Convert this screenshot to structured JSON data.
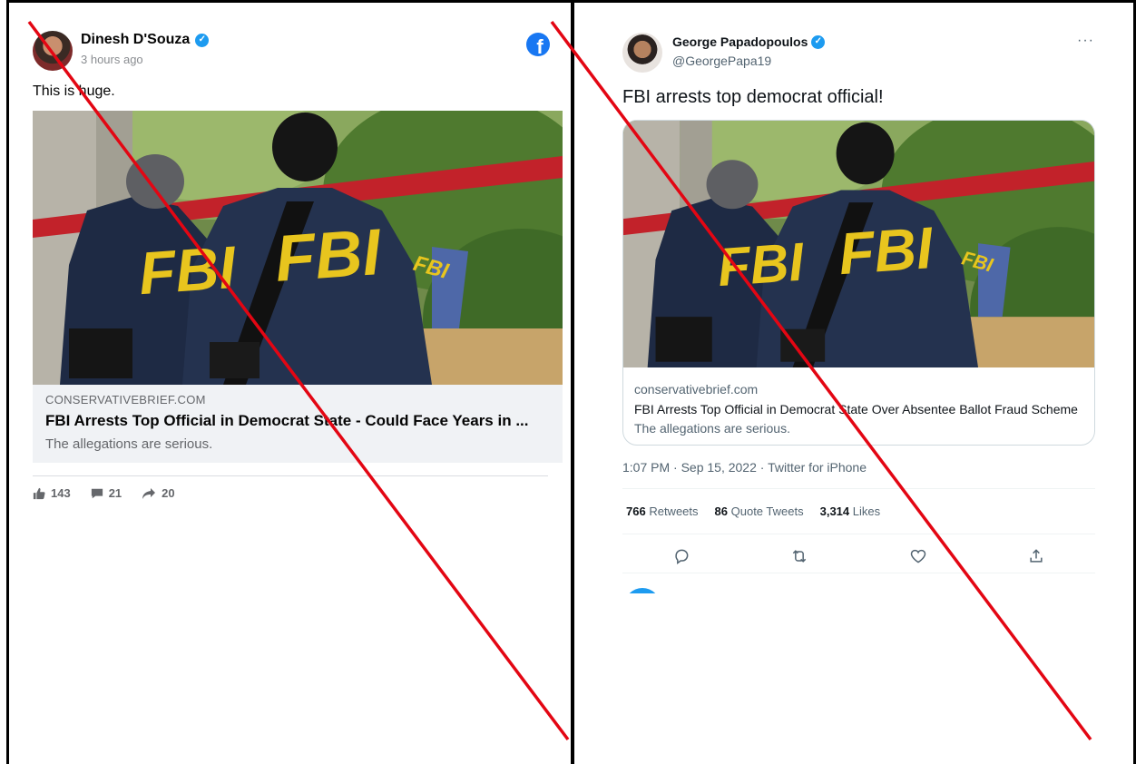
{
  "facebook_post": {
    "author": "Dinesh D'Souza",
    "timestamp": "3 hours ago",
    "text": "This is huge.",
    "link": {
      "domain": "CONSERVATIVEBRIEF.COM",
      "headline": "FBI Arrests Top Official in Democrat State - Could Face Years in ...",
      "description": "The allegations are serious."
    },
    "reactions": {
      "likes": "143",
      "comments": "21",
      "shares": "20"
    },
    "brand_color": "#1877f2"
  },
  "twitter_post": {
    "author": "George Papadopoulos",
    "handle": "@GeorgePapa19",
    "text": "FBI arrests top democrat official!",
    "card": {
      "domain": "conservativebrief.com",
      "title": "FBI Arrests Top Official in Democrat State Over Absentee Ballot Fraud Scheme",
      "description": "The allegations are serious."
    },
    "meta": "1:07 PM · Sep 15, 2022 · Twitter for iPhone",
    "stats": {
      "retweets_count": "766",
      "retweets_label": "Retweets",
      "quotes_count": "86",
      "quotes_label": "Quote Tweets",
      "likes_count": "3,314",
      "likes_label": "Likes"
    },
    "more_label": "···",
    "verified_color": "#1d9bf0"
  },
  "photo_text": {
    "jacket_left": "FBI",
    "jacket_right": "FBI",
    "sleeve": "FBI"
  },
  "overlay": {
    "line_color": "#e30613"
  }
}
